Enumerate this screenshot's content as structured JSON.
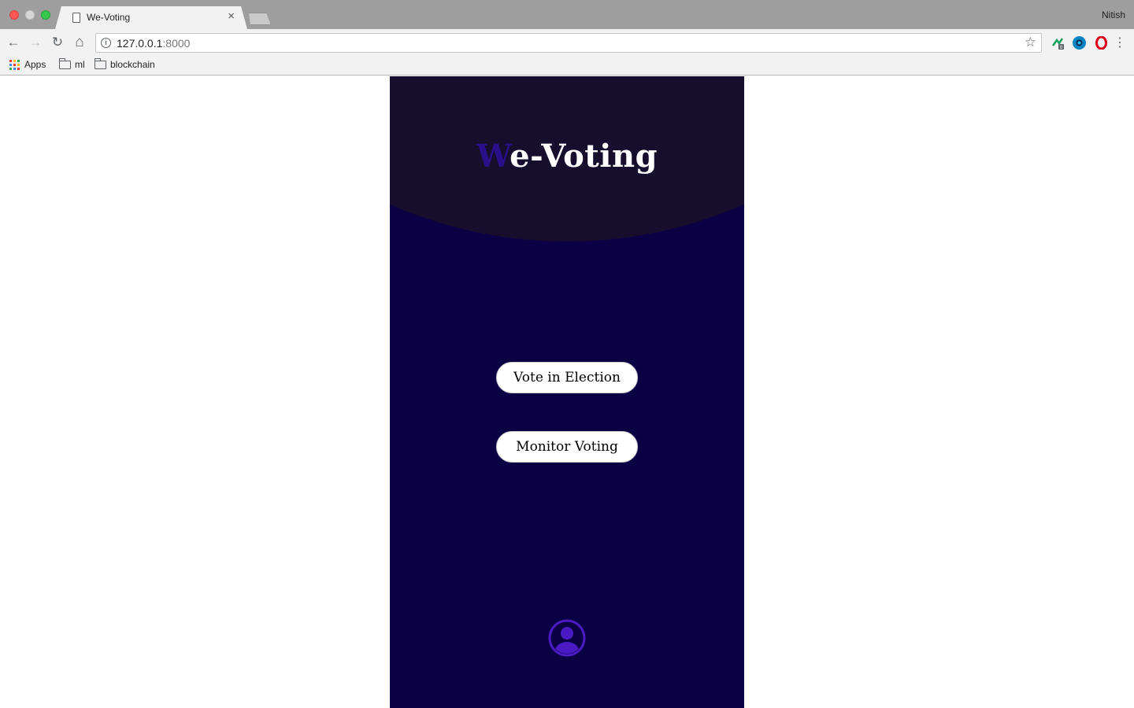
{
  "browser": {
    "tab_title": "We-Voting",
    "tab_close": "×",
    "profile_name": "Nitish",
    "url_host": "127.0.0.1",
    "url_port": ":8000",
    "info_glyph": "i",
    "back_glyph": "←",
    "forward_glyph": "→",
    "reload_glyph": "↻",
    "home_glyph": "⌂",
    "star_glyph": "☆",
    "menu_glyph": "⋮",
    "icons": [
      "back-icon",
      "forward-icon",
      "reload-icon",
      "home-icon",
      "info-icon",
      "star-icon",
      "menu-icon"
    ],
    "bookmarks": [
      {
        "label": "Apps",
        "icon": "apps-grid-icon"
      },
      {
        "label": "ml",
        "icon": "folder-icon"
      },
      {
        "label": "blockchain",
        "icon": "folder-icon"
      }
    ],
    "extension_colors": [
      "#1aa260",
      "#0b84c6",
      "#e0001b"
    ]
  },
  "app": {
    "title_accent": "W",
    "title_rest": "e-Voting",
    "buttons": {
      "vote_label": "Vote in Election",
      "monitor_label": "Monitor Voting"
    },
    "colors": {
      "background": "#0c0045",
      "header": "#170e2d",
      "accent": "#2a0f8a",
      "user_icon": "#4a1bc4"
    }
  }
}
